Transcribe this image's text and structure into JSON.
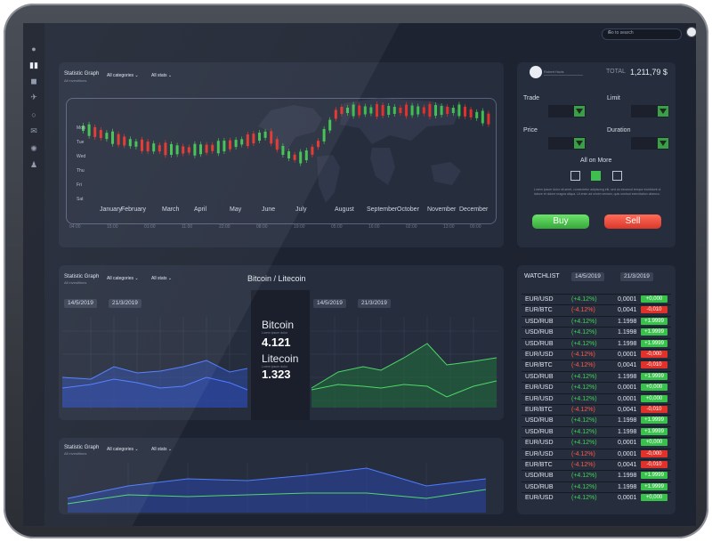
{
  "search": {
    "placeholder": "Go to search"
  },
  "sidebar": {
    "icons": [
      "user-icon",
      "bar-chart-icon",
      "chat-icon",
      "plane-icon",
      "search-icon",
      "mail-icon",
      "settings-icon",
      "users-icon"
    ]
  },
  "panel1": {
    "title": "Statistic Graph",
    "subtitle": "All investitions",
    "categories": "All categories",
    "stats": "All stats",
    "days": [
      "Mon",
      "Tue",
      "Wed",
      "Thu",
      "Fri",
      "Sat"
    ],
    "months": [
      "January",
      "February",
      "March",
      "April",
      "May",
      "June",
      "July",
      "August",
      "September",
      "October",
      "November",
      "December"
    ],
    "hours": [
      "04:00",
      "15:00",
      "01:00",
      "11:00",
      "22:00",
      "08:00",
      "19:00",
      "05:00",
      "16:00",
      "02:00",
      "13:00",
      "00:00"
    ]
  },
  "trade": {
    "user": "Robert Huds",
    "total_label": "TOTAL",
    "total_value": "1,211,79 $",
    "trade": "Trade",
    "limit": "Limit",
    "price": "Price",
    "duration": "Duration",
    "all_on_more": "All on More",
    "disclaimer": "Lorem ipsum dolor sit amet, consectetur adipiscing elit, sed do eiusmod tempor incididunt ut labore et dolore magna aliqua. Ut enim ad minim veniam, quis nostrud exercitation ullamco.",
    "buy": "Buy",
    "sell": "Sell"
  },
  "panel2": {
    "title": "Statistic Graph",
    "subtitle": "All investitions",
    "categories": "All categories",
    "stats": "All stats",
    "heading": "Bitcoin / Litecoin",
    "date1": "14/5/2019",
    "date2": "21/3/2019",
    "date3": "14/5/2019",
    "date4": "21/3/2019",
    "btc_name": "Bitcoin",
    "btc_value": "4.121",
    "ltc_name": "Litecoin",
    "ltc_value": "1.323",
    "note": "Lorem ipsum dolor"
  },
  "panel3": {
    "title": "Statistic Graph",
    "subtitle": "All investitions",
    "categories": "All categories",
    "stats": "All stats"
  },
  "watchlist": {
    "title": "WATCHLIST",
    "date1": "14/5/2019",
    "date2": "21/3/2019",
    "rows": [
      {
        "pair": "EUR/USD",
        "pct": "(+4.12%)",
        "val": "0,0001",
        "badge": "+0,000",
        "dir": "up"
      },
      {
        "pair": "EUR/BTC",
        "pct": "(-4.12%)",
        "val": "0,0041",
        "badge": "-0,010",
        "dir": "down"
      },
      {
        "pair": "USD/RUB",
        "pct": "(+4.12%)",
        "val": "1.1998",
        "badge": "+1.9999",
        "dir": "up"
      },
      {
        "pair": "USD/RUB",
        "pct": "(+4.12%)",
        "val": "1.1998",
        "badge": "+1.9999",
        "dir": "up"
      },
      {
        "pair": "USD/RUB",
        "pct": "(+4.12%)",
        "val": "1.1998",
        "badge": "+1.9999",
        "dir": "up"
      },
      {
        "pair": "EUR/USD",
        "pct": "(-4.12%)",
        "val": "0,0001",
        "badge": "-0,000",
        "dir": "down"
      },
      {
        "pair": "EUR/BTC",
        "pct": "(-4.12%)",
        "val": "0,0041",
        "badge": "-0,010",
        "dir": "down"
      },
      {
        "pair": "USD/RUB",
        "pct": "(+4.12%)",
        "val": "1.1998",
        "badge": "+1.9999",
        "dir": "up"
      },
      {
        "pair": "EUR/USD",
        "pct": "(+4.12%)",
        "val": "0,0001",
        "badge": "+0,000",
        "dir": "up"
      },
      {
        "pair": "EUR/USD",
        "pct": "(+4.12%)",
        "val": "0,0001",
        "badge": "+0,000",
        "dir": "up"
      },
      {
        "pair": "EUR/BTC",
        "pct": "(-4.12%)",
        "val": "0,0041",
        "badge": "-0,010",
        "dir": "down"
      },
      {
        "pair": "USD/RUB",
        "pct": "(+4.12%)",
        "val": "1.1998",
        "badge": "+1.9999",
        "dir": "up"
      },
      {
        "pair": "USD/RUB",
        "pct": "(+4.12%)",
        "val": "1.1998",
        "badge": "+1.9999",
        "dir": "up"
      },
      {
        "pair": "EUR/USD",
        "pct": "(+4.12%)",
        "val": "0,0001",
        "badge": "+0,000",
        "dir": "up"
      },
      {
        "pair": "EUR/USD",
        "pct": "(-4.12%)",
        "val": "0,0001",
        "badge": "-0,000",
        "dir": "down"
      },
      {
        "pair": "EUR/BTC",
        "pct": "(-4.12%)",
        "val": "0,0041",
        "badge": "-0,010",
        "dir": "down"
      },
      {
        "pair": "USD/RUB",
        "pct": "(+4.12%)",
        "val": "1.1998",
        "badge": "+1.9999",
        "dir": "up"
      },
      {
        "pair": "USD/RUB",
        "pct": "(+4.12%)",
        "val": "1.1998",
        "badge": "+1.9999",
        "dir": "up"
      },
      {
        "pair": "EUR/USD",
        "pct": "(+4.12%)",
        "val": "0,0001",
        "badge": "+0,000",
        "dir": "up"
      }
    ]
  },
  "colors": {
    "up": "#39c24b",
    "down": "#e0322a",
    "accent_blue": "#3b6fe0",
    "accent_green": "#3fbf4f",
    "screen_bg": "#1d2331",
    "panel_bg": "#262d3d"
  }
}
